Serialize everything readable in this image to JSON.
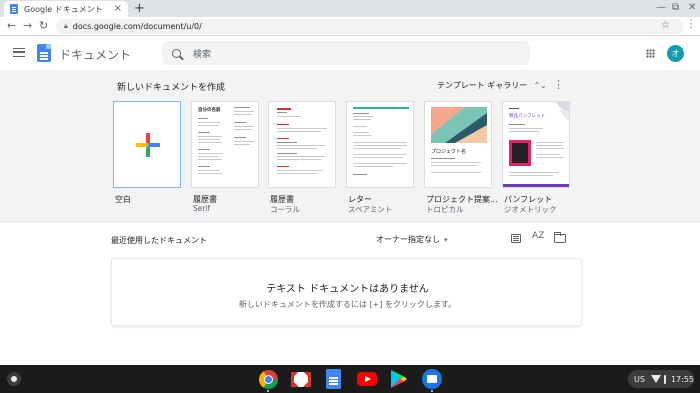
{
  "browser": {
    "tab_title": "Google ドキュメント",
    "tab_close": "×",
    "new_tab": "+",
    "url": "docs.google.com/document/u/0/",
    "back": "←",
    "forward": "→",
    "reload": "↻",
    "bookmark_star": "☆",
    "menu": "⋮",
    "minimize": "—",
    "maximize": "⧉",
    "close": "✕"
  },
  "header": {
    "app_title": "ドキュメント",
    "search_placeholder": "検索",
    "avatar_initial": "オ"
  },
  "templates": {
    "heading": "新しいドキュメントを作成",
    "gallery_label": "テンプレート ギャラリー",
    "gallery_chevron": "⌃⌄",
    "kebab": "⋮",
    "items": [
      {
        "name": "空白",
        "subtitle": ""
      },
      {
        "name": "履歴書",
        "subtitle": "Serif"
      },
      {
        "name": "履歴書",
        "subtitle": "コーラル"
      },
      {
        "name": "レター",
        "subtitle": "スペアミント"
      },
      {
        "name": "プロジェクト提案...",
        "subtitle": "トロピカル"
      },
      {
        "name": "パンフレット",
        "subtitle": "ジオメトリック"
      }
    ],
    "resume_serif_name": "自分の名前",
    "project_card_title": "プロジェクト名",
    "brochure_card_title": "製品パンフレット"
  },
  "recent": {
    "title": "最近使用したドキュメント",
    "owner_filter": "オーナー指定なし",
    "owner_chevron": "▾",
    "sort_icon_text": "AZ",
    "empty_title": "テキスト ドキュメントはありません",
    "empty_subtitle": "新しいドキュメントを作成するには [+] をクリックします。"
  },
  "shelf": {
    "locale": "US",
    "time": "17:55"
  },
  "colors": {
    "docs_blue": "#4285f4",
    "plus_red": "#ea4335",
    "plus_yellow": "#fbbc04",
    "plus_green": "#34a853",
    "avatar_teal": "#129eaf"
  }
}
